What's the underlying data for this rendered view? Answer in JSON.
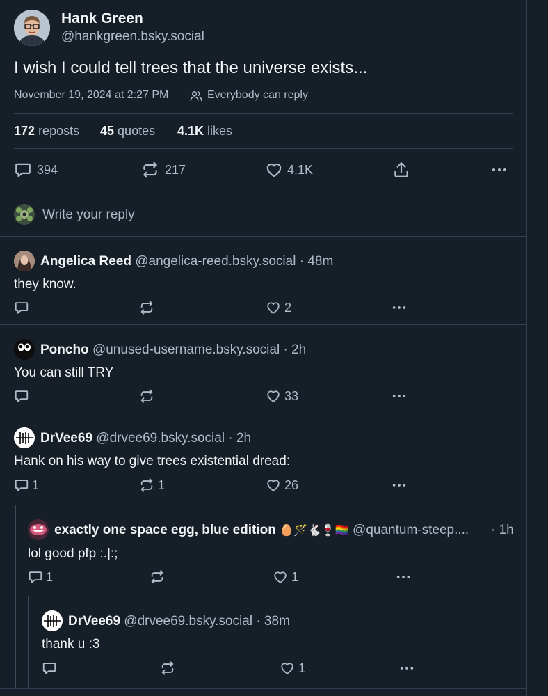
{
  "main_post": {
    "author_name": "Hank Green",
    "author_handle": "@hankgreen.bsky.social",
    "text": "I wish I could tell trees that the universe exists...",
    "timestamp": "November 19, 2024 at 2:27 PM",
    "reply_setting": "Everybody can reply",
    "stats": {
      "reposts_count": "172",
      "reposts_label": "reposts",
      "quotes_count": "45",
      "quotes_label": "quotes",
      "likes_count": "4.1K",
      "likes_label": "likes"
    },
    "actions": {
      "replies": "394",
      "reposts": "217",
      "likes": "4.1K"
    }
  },
  "reply_box": {
    "placeholder": "Write your reply"
  },
  "replies": [
    {
      "author_name": "Angelica Reed",
      "author_handle": "@angelica-reed.bsky.social",
      "time": "· 48m",
      "text": "they know.",
      "counts": {
        "replies": "",
        "reposts": "",
        "likes": "2"
      }
    },
    {
      "author_name": "Poncho",
      "author_handle": "@unused-username.bsky.social",
      "time": "· 2h",
      "text": "You can still TRY",
      "counts": {
        "replies": "",
        "reposts": "",
        "likes": "33"
      }
    },
    {
      "author_name": "DrVee69",
      "author_handle": "@drvee69.bsky.social",
      "time": "· 2h",
      "text": "Hank on his way to give trees existential dread:",
      "counts": {
        "replies": "1",
        "reposts": "1",
        "likes": "26"
      }
    },
    {
      "author_name": "exactly one space egg, blue edition",
      "author_emojis": "🥚🪄🐇🍷🏳️‍🌈",
      "author_handle": "@quantum-steep....",
      "time": "· 1h",
      "text": "lol good pfp :.|:;",
      "counts": {
        "replies": "1",
        "reposts": "",
        "likes": "1"
      }
    },
    {
      "author_name": "DrVee69",
      "author_handle": "@drvee69.bsky.social",
      "time": "· 38m",
      "text": "thank u :3",
      "counts": {
        "replies": "",
        "reposts": "",
        "likes": "1"
      }
    }
  ],
  "colors": {
    "background": "#161e27",
    "text": "#f1f3f5",
    "muted": "#aebbc9",
    "border": "#2e4052"
  }
}
